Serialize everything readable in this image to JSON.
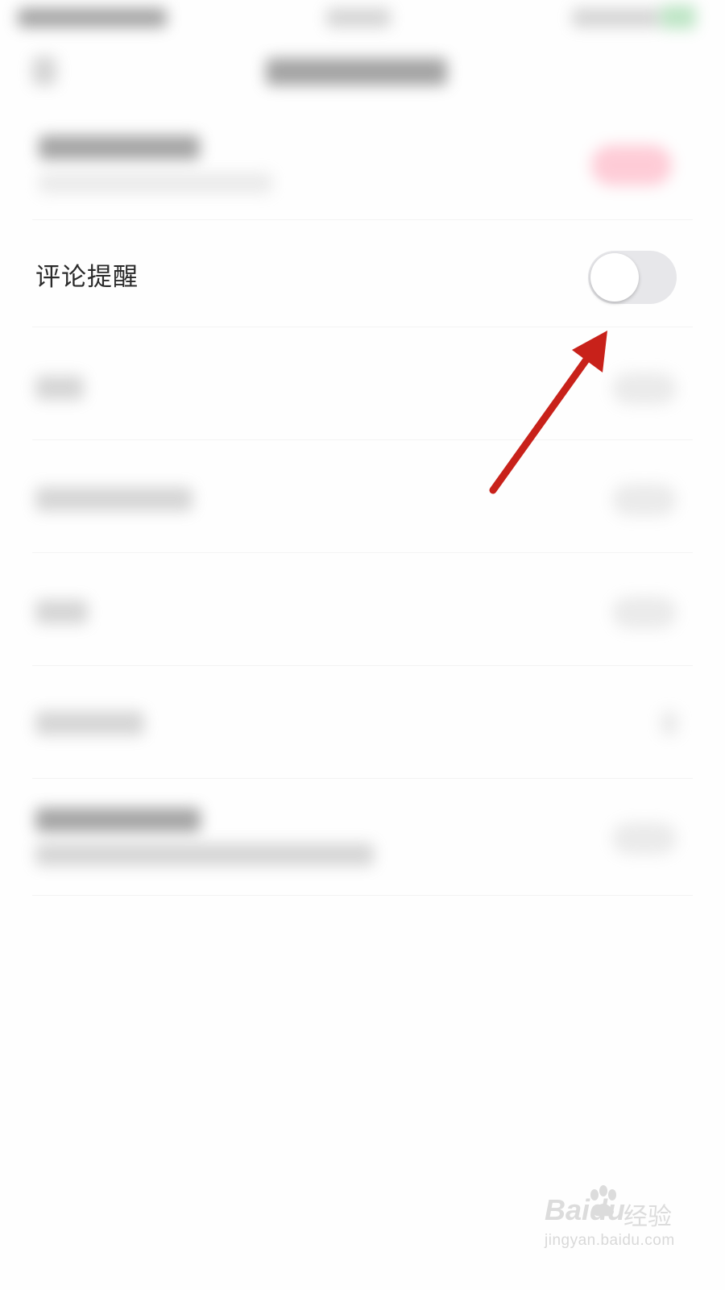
{
  "settings": {
    "comment_reminder": {
      "label": "评论提醒",
      "enabled": false
    }
  },
  "watermark": {
    "brand": "Baidu",
    "brand_cn": "经验",
    "url": "jingyan.baidu.com"
  },
  "colors": {
    "toggle_off_track": "#e7e7ea",
    "toggle_knob": "#ffffff",
    "annotation_arrow": "#c8211a",
    "label_text": "#2a2a2a"
  }
}
